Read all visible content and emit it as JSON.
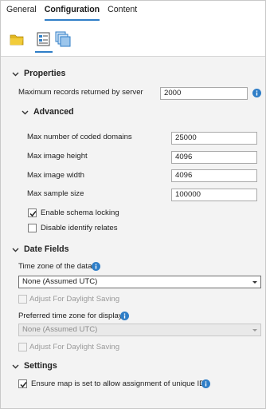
{
  "tabs": [
    "General",
    "Configuration",
    "Content"
  ],
  "colors": {
    "accent": "#2f7ec7",
    "info": "#2f7ec7",
    "panel": "#f3f3f3"
  },
  "properties": {
    "heading": "Properties",
    "max_records_label": "Maximum records returned by server",
    "max_records_value": "2000",
    "advanced": {
      "heading": "Advanced",
      "coded_domains_label": "Max number of coded domains",
      "coded_domains_value": "25000",
      "image_height_label": "Max image height",
      "image_height_value": "4096",
      "image_width_label": "Max image width",
      "image_width_value": "4096",
      "sample_size_label": "Max sample size",
      "sample_size_value": "100000",
      "schema_locking_label": "Enable schema locking",
      "schema_locking_checked": true,
      "identify_relates_label": "Disable identify relates",
      "identify_relates_checked": false
    }
  },
  "date_fields": {
    "heading": "Date Fields",
    "timezone_label": "Time zone of the data",
    "timezone_value": "None (Assumed UTC)",
    "daylight_label_1": "Adjust For Daylight Saving",
    "preferred_label": "Preferred time zone for display",
    "preferred_value": "None (Assumed UTC)",
    "daylight_label_2": "Adjust For Daylight Saving"
  },
  "settings": {
    "heading": "Settings",
    "unique_ids_label": "Ensure map is set to allow assignment of unique IDs",
    "unique_ids_checked": true
  }
}
